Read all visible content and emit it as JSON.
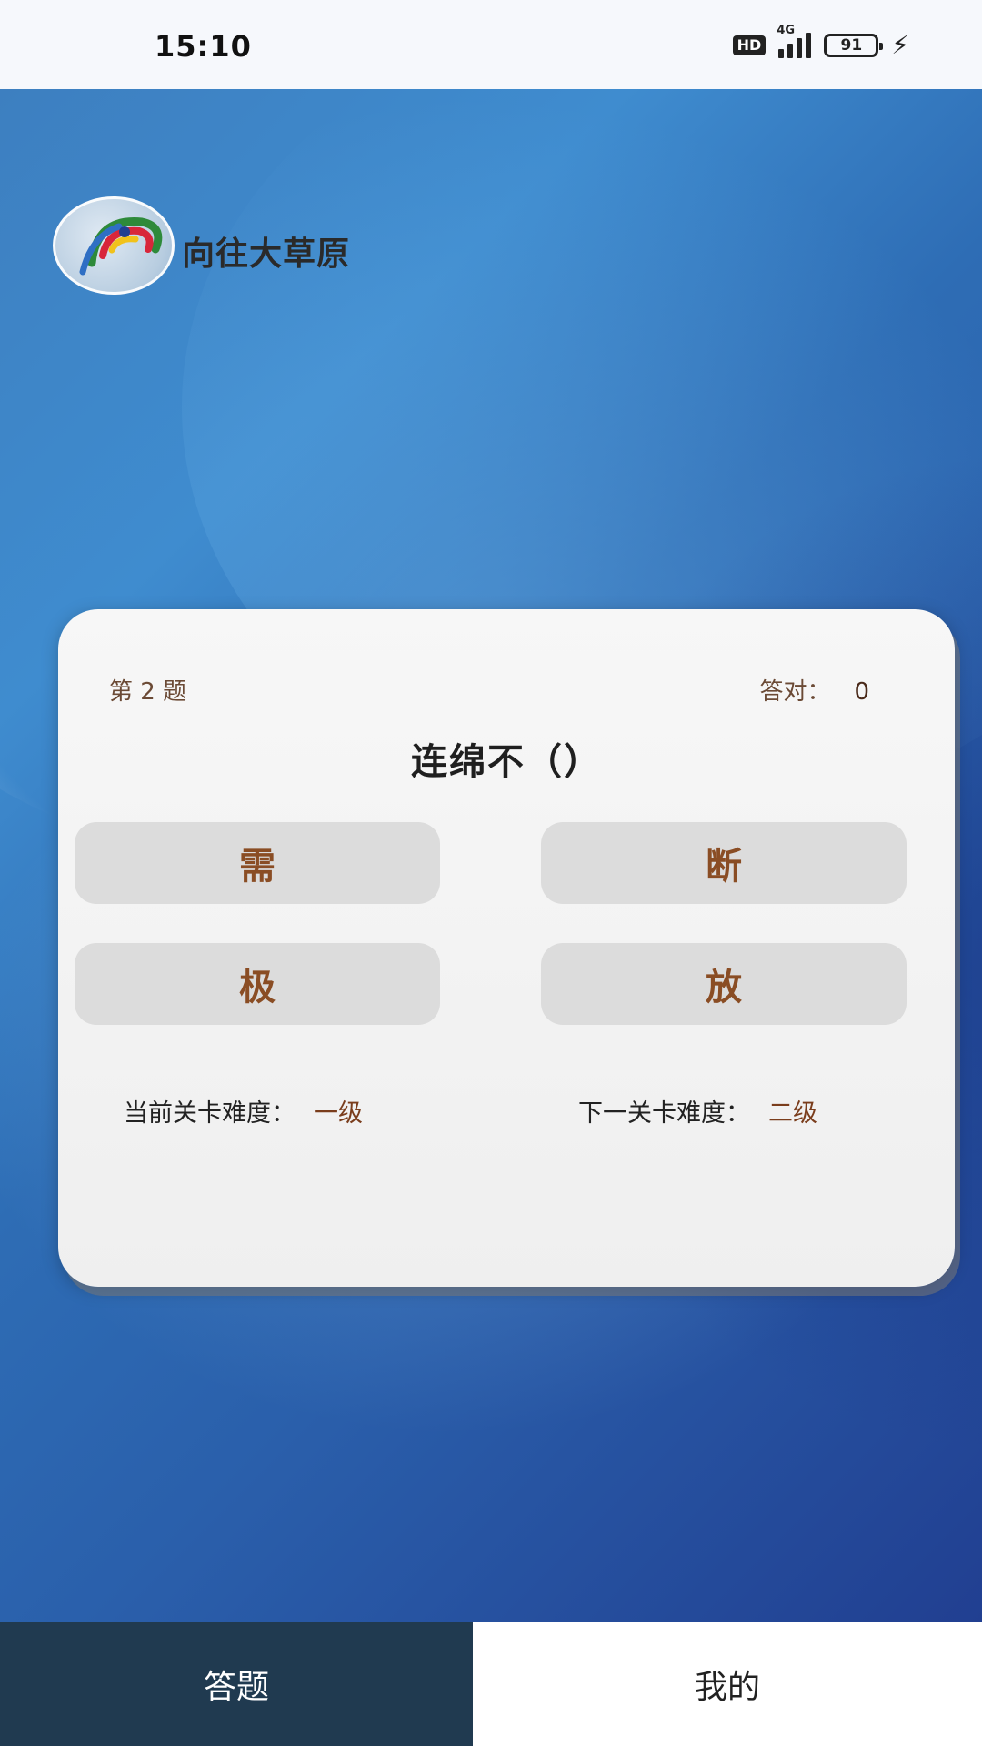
{
  "status_bar": {
    "time": "15:10",
    "hd": "HD",
    "network": "4G",
    "battery": "91",
    "icons": [
      "hd-icon",
      "signal-icon",
      "battery-icon",
      "charging-icon"
    ]
  },
  "brand": {
    "name": "向往大草原",
    "logo_icon": "swirl-logo-icon"
  },
  "quiz": {
    "question_number": "第 2 题",
    "score_label": "答对：",
    "score_value": "0",
    "question": "连绵不（）",
    "options": [
      "需",
      "断",
      "极",
      "放"
    ],
    "current_level_label": "当前关卡难度：",
    "current_level_value": "一级",
    "next_level_label": "下一关卡难度：",
    "next_level_value": "二级"
  },
  "tabs": [
    {
      "label": "答题",
      "active": true
    },
    {
      "label": "我的",
      "active": false
    }
  ],
  "colors": {
    "tab_active_bg": "#203a50",
    "option_text": "#8a4d24",
    "card_bg": "#f2f2f2"
  }
}
